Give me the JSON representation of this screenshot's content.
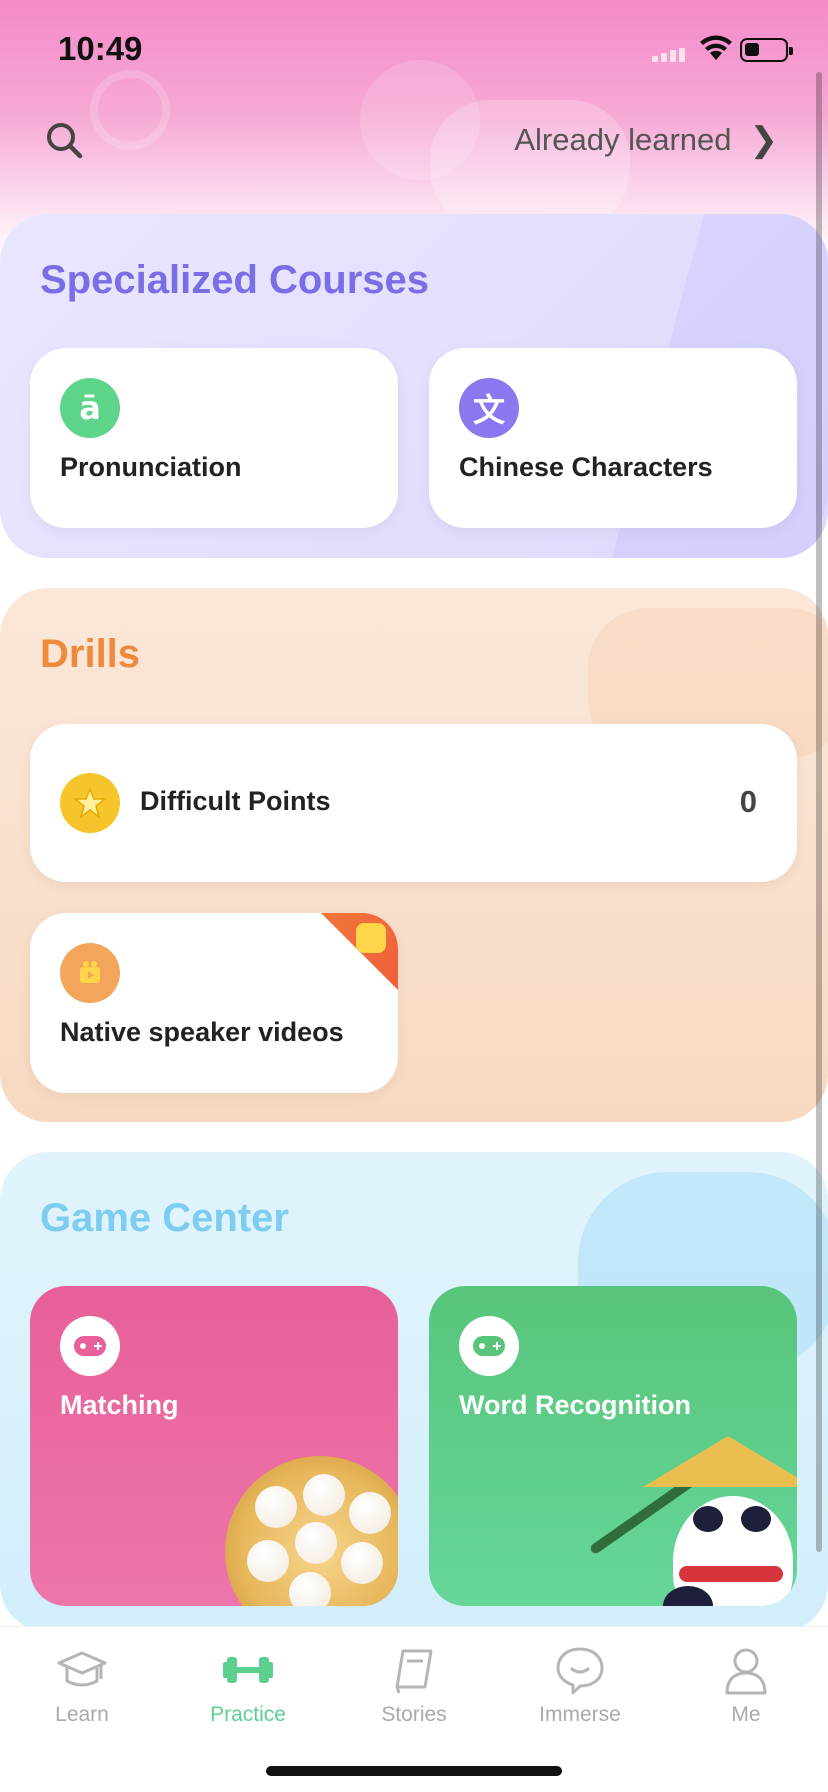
{
  "status_bar": {
    "time": "10:49"
  },
  "header": {
    "already_learned": "Already learned",
    "chevron": "❯"
  },
  "sections": {
    "courses": {
      "title": "Specialized Courses",
      "cards": [
        {
          "label": "Pronunciation",
          "icon": "pronunciation-icon",
          "glyph": "ā",
          "color": "#5fd48b"
        },
        {
          "label": "Chinese Characters",
          "icon": "chinese-character-icon",
          "glyph": "文",
          "color": "#8b78f0"
        }
      ]
    },
    "drills": {
      "title": "Drills",
      "difficult_points": {
        "label": "Difficult Points",
        "count": "0",
        "icon": "star-icon",
        "color": "#f6c42b"
      },
      "native_videos": {
        "label": "Native speaker videos",
        "icon": "video-icon",
        "color": "#f3a55c"
      }
    },
    "games": {
      "title": "Game Center",
      "cards": [
        {
          "label": "Matching",
          "icon": "gamepad-icon",
          "color": "#e85f99"
        },
        {
          "label": "Word Recognition",
          "icon": "gamepad-icon",
          "color": "#58c57b"
        }
      ]
    }
  },
  "tabs": [
    {
      "label": "Learn",
      "icon": "graduation-cap-icon",
      "active": false
    },
    {
      "label": "Practice",
      "icon": "dumbbell-icon",
      "active": true
    },
    {
      "label": "Stories",
      "icon": "book-icon",
      "active": false
    },
    {
      "label": "Immerse",
      "icon": "chat-bubble-icon",
      "active": false
    },
    {
      "label": "Me",
      "icon": "person-icon",
      "active": false
    }
  ],
  "colors": {
    "accent": "#5bd08f",
    "courses_title": "#7a6ee6",
    "drills_title": "#ef8a3c",
    "games_title": "#7ccdf0"
  }
}
